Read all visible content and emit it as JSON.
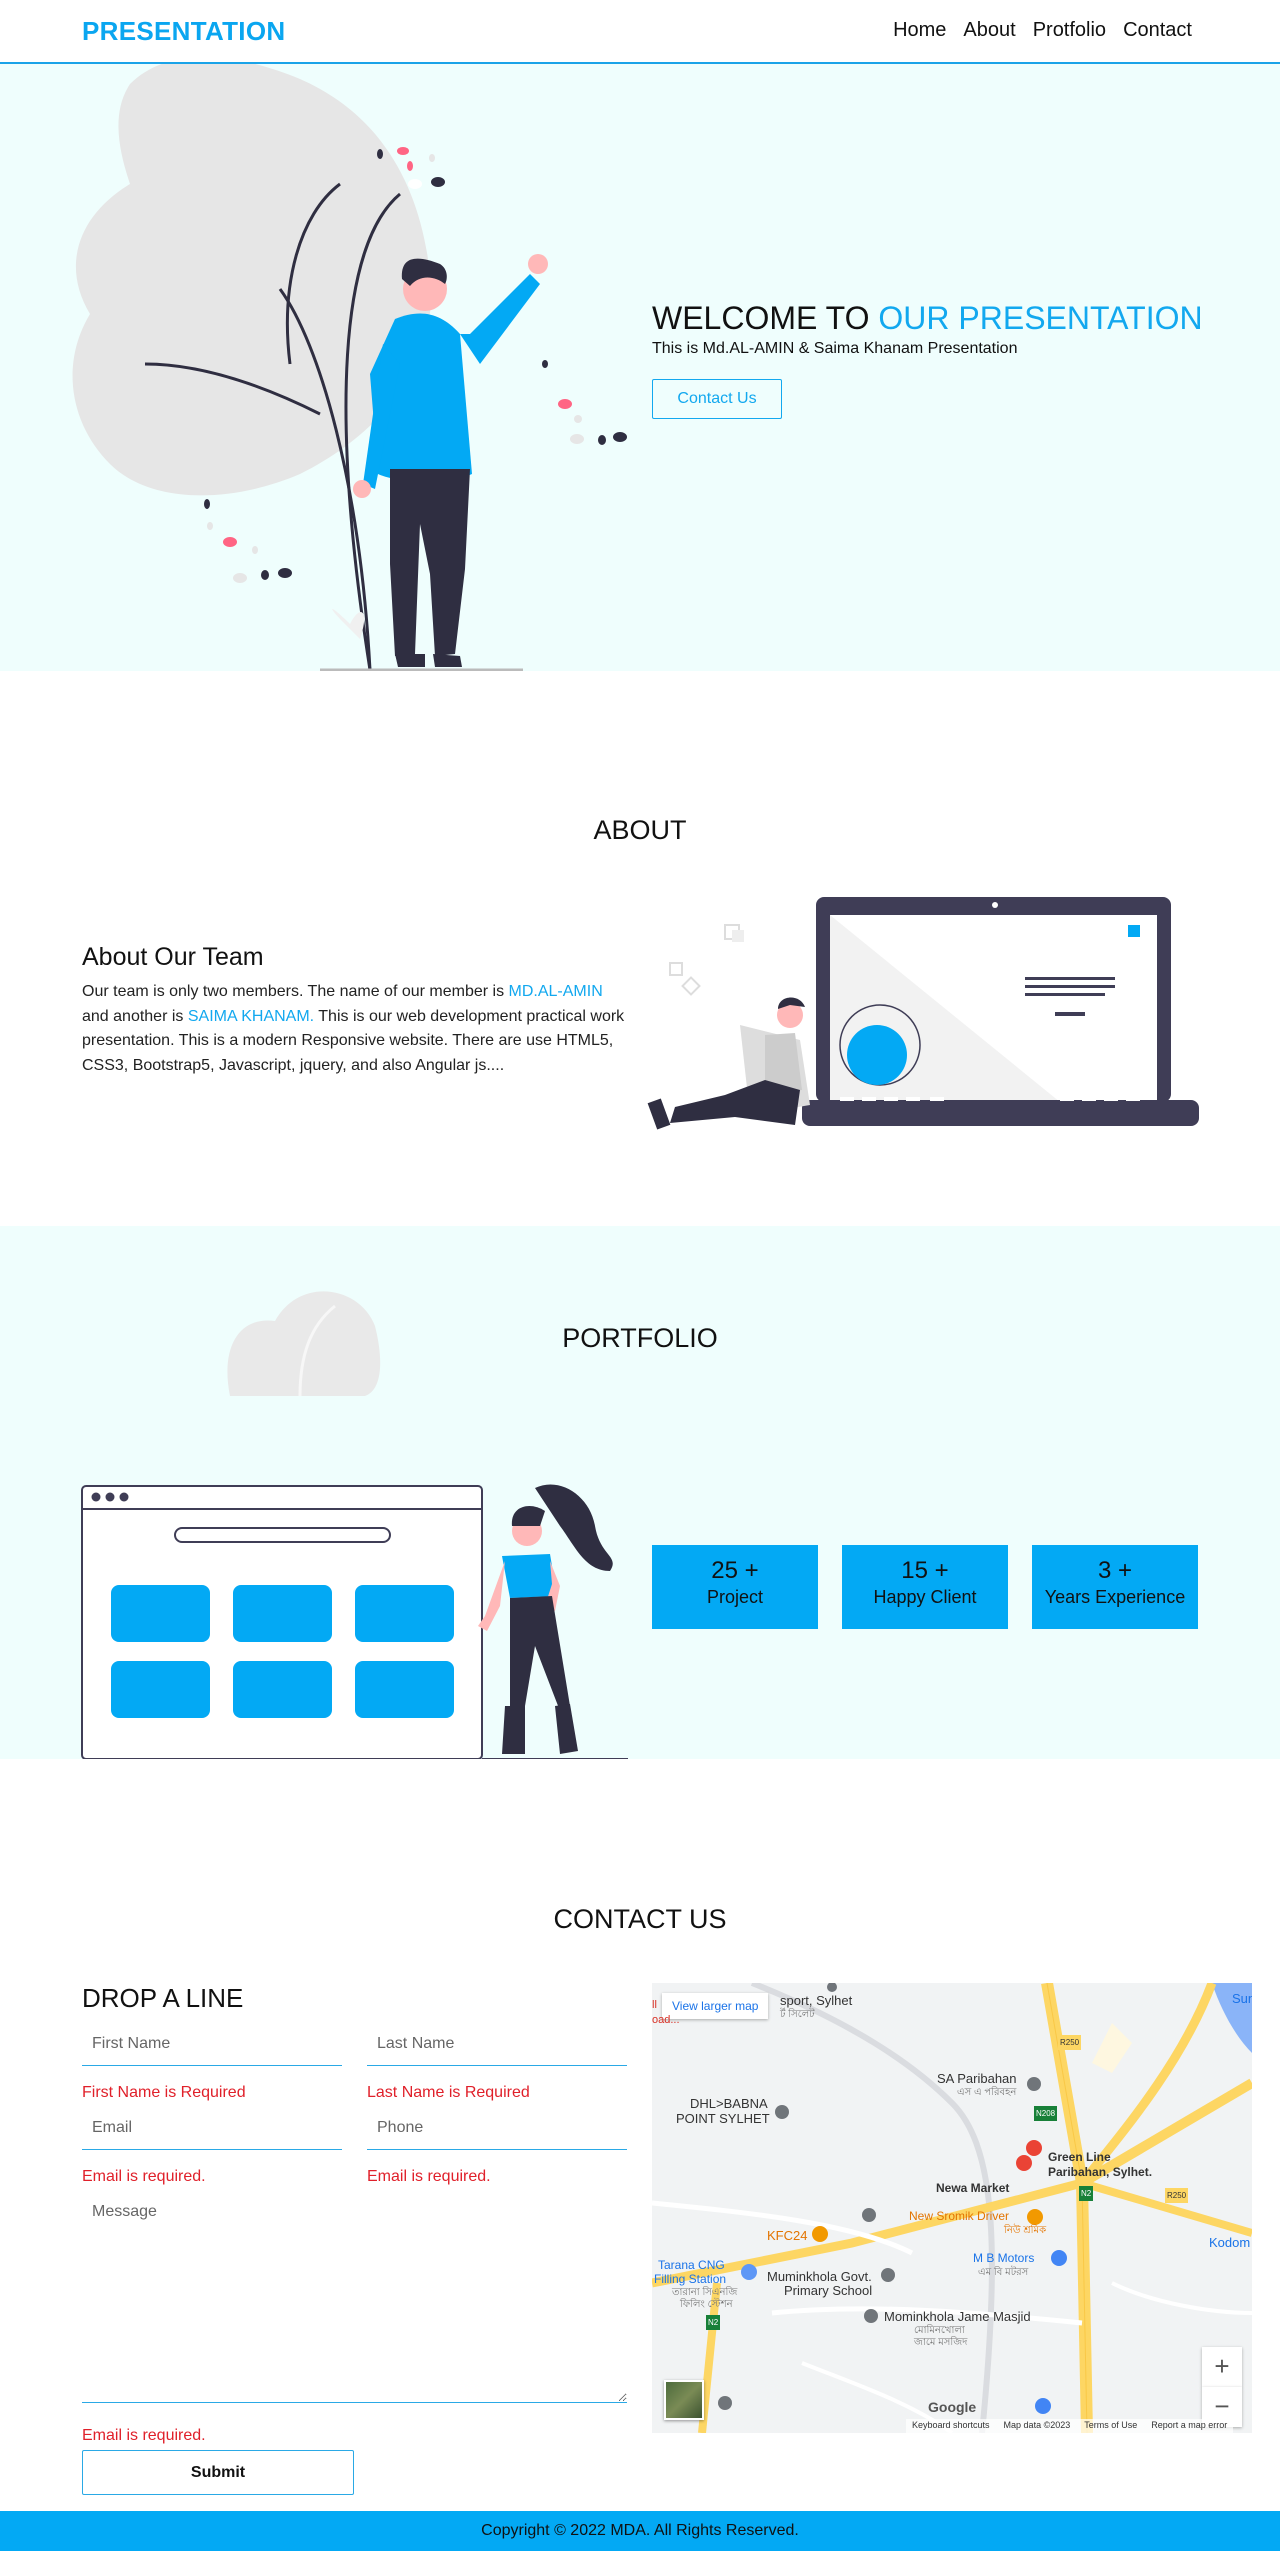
{
  "nav": {
    "brand": "PRESENTATION",
    "links": [
      "Home",
      "About",
      "Protfolio",
      "Contact"
    ]
  },
  "hero": {
    "title_prefix": "WELCOME TO ",
    "title_accent": "OUR PRESENTATION",
    "subtitle": "This is Md.AL-AMIN & Saima Khanam Presentation",
    "cta": "Contact Us"
  },
  "about": {
    "section_title": "ABOUT",
    "heading": "About Our Team",
    "p1": "Our team is only two members. The name of our member is ",
    "name1": "MD.AL-AMIN",
    "p2": " and another is ",
    "name2": "SAIMA KHANAM.",
    "p3": " This is our web development practical work presentation. This is a modern Responsive website. There are use HTML5, CSS3, Bootstrap5, Javascript, jquery, and also Angular js...."
  },
  "portfolio": {
    "section_title": "PORTFOLIO",
    "stats": [
      {
        "num": "25 +",
        "label": "Project"
      },
      {
        "num": "15 +",
        "label": "Happy Client"
      },
      {
        "num": "3 +",
        "label": "Years Experience"
      }
    ]
  },
  "contact": {
    "section_title": "CONTACT US",
    "heading": "DROP A LINE",
    "first_name_ph": "First Name",
    "last_name_ph": "Last Name",
    "email_ph": "Email",
    "phone_ph": "Phone",
    "message_ph": "Message",
    "err_first": "First Name is Required",
    "err_last": "Last Name is Required",
    "err_email": "Email is required.",
    "err_phone": "Email is required.",
    "err_message": "Email is required.",
    "submit": "Submit"
  },
  "map": {
    "view_larger": "View larger map",
    "labels": {
      "top_left_1": "ll",
      "top_left_2": "oad...",
      "airport": "sport, Sylhet",
      "airport_bn": "র্ট সিলেট",
      "sa_paribahan": "SA Paribahan",
      "sa_paribahan_bn": "এস এ পরিবহন",
      "dhl_1": "DHL>BABNA",
      "dhl_2": "POINT SYLHET",
      "green_line_1": "Green Line",
      "green_line_2": "Paribahan, Sylhet.",
      "newa_market": "Newa Market",
      "new_sromik_1": "New Sromik Driver",
      "new_sromik_2": "নিউ শ্রমিক",
      "kfc": "KFC24",
      "mb_motors_1": "M B Motors",
      "mb_motors_2": "এম বি মটরস",
      "tarana_1": "Tarana CNG",
      "tarana_2": "Filling Station",
      "tarana_3": "তারানা সিএনজি",
      "tarana_4": "ফিলিং স্টেশন",
      "muminkhola_1": "Muminkhola Govt.",
      "muminkhola_2": "Primary School",
      "mominkhola_masjid_1": "Mominkhola Jame Masjid",
      "mominkhola_masjid_2": "মোমিনখোলা",
      "mominkhola_masjid_3": "জামে মসজিদ",
      "kodom": "Kodom",
      "sun": "Sun",
      "r250a": "R250",
      "n208": "N208",
      "n2a": "N2",
      "r250b": "R250",
      "n2b": "N2"
    },
    "zoom_in": "+",
    "zoom_out": "−",
    "google": "Google",
    "footer_links": [
      "Keyboard shortcuts",
      "Map data ©2023",
      "Terms of Use",
      "Report a map error"
    ]
  },
  "footer": {
    "text": "Copyright © 2022 MDA. All Rights Reserved."
  },
  "colors": {
    "accent": "#03a9f4",
    "hero_bg": "#effefd",
    "error": "#e0202a",
    "dark_figure": "#2f2e41"
  }
}
